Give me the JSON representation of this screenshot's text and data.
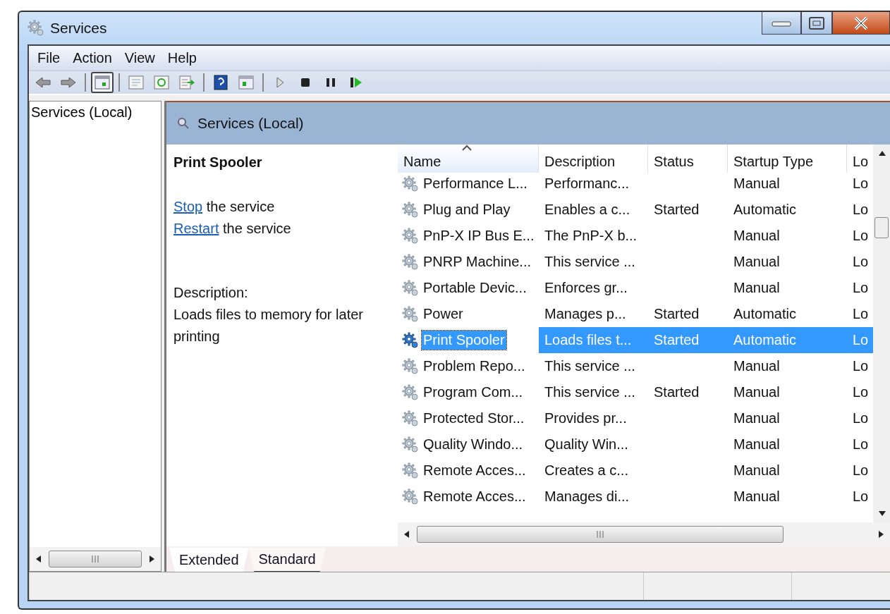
{
  "window": {
    "title": "Services"
  },
  "menu": [
    "File",
    "Action",
    "View",
    "Help"
  ],
  "toolbar": [
    {
      "kind": "back",
      "selected": false
    },
    {
      "kind": "forward",
      "selected": false
    },
    {
      "kind": "separator"
    },
    {
      "kind": "console",
      "selected": true
    },
    {
      "kind": "separator"
    },
    {
      "kind": "properties",
      "selected": false
    },
    {
      "kind": "refresh",
      "selected": false
    },
    {
      "kind": "export",
      "selected": false
    },
    {
      "kind": "separator"
    },
    {
      "kind": "help",
      "selected": false
    },
    {
      "kind": "view",
      "selected": false
    },
    {
      "kind": "separator"
    },
    {
      "kind": "play",
      "selected": false
    },
    {
      "kind": "stop",
      "selected": false
    },
    {
      "kind": "pause",
      "selected": false
    },
    {
      "kind": "resume",
      "selected": false
    }
  ],
  "tree": {
    "items": [
      {
        "label": "Services (Local)",
        "selected": false
      }
    ]
  },
  "header": {
    "title": "Services (Local)"
  },
  "details": {
    "title": "Print Spooler",
    "actions": [
      {
        "link": "Stop",
        "text": " the service"
      },
      {
        "link": "Restart",
        "text": " the service"
      }
    ],
    "description_label": "Description:",
    "description": "Loads files to memory for later printing"
  },
  "table": {
    "columns": [
      {
        "label": "Name",
        "sorted": true
      },
      {
        "label": "Description",
        "sorted": false
      },
      {
        "label": "Status",
        "sorted": false
      },
      {
        "label": "Startup Type",
        "sorted": false
      },
      {
        "label": "Lo",
        "sorted": false
      }
    ],
    "rows": [
      {
        "name": "Performance L...",
        "description": "Performanc...",
        "startup": "Manual",
        "logon": "Lo",
        "selected": false
      },
      {
        "name": "Plug and Play",
        "description": "Enables a c...",
        "status": "Started",
        "startup": "Automatic",
        "logon": "Lo",
        "selected": false
      },
      {
        "name": "PnP-X IP Bus E...",
        "description": "The PnP-X b...",
        "startup": "Manual",
        "logon": "Lo",
        "selected": false
      },
      {
        "name": "PNRP Machine...",
        "description": "This service ...",
        "startup": "Manual",
        "logon": "Lo",
        "selected": false
      },
      {
        "name": "Portable Devic...",
        "description": "Enforces gr...",
        "startup": "Manual",
        "logon": "Lo",
        "selected": false
      },
      {
        "name": "Power",
        "description": "Manages p...",
        "status": "Started",
        "startup": "Automatic",
        "logon": "Lo",
        "selected": false
      },
      {
        "name": "Print Spooler",
        "description": "Loads files t...",
        "status": "Started",
        "startup": "Automatic",
        "logon": "Lo",
        "selected": true
      },
      {
        "name": "Problem Repo...",
        "description": "This service ...",
        "startup": "Manual",
        "logon": "Lo",
        "selected": false
      },
      {
        "name": "Program Com...",
        "description": "This service ...",
        "status": "Started",
        "startup": "Manual",
        "logon": "Lo",
        "selected": false
      },
      {
        "name": "Protected Stor...",
        "description": "Provides pr...",
        "startup": "Manual",
        "logon": "Lo",
        "selected": false
      },
      {
        "name": "Quality Windo...",
        "description": "Quality Win...",
        "startup": "Manual",
        "logon": "Lo",
        "selected": false
      },
      {
        "name": "Remote Acces...",
        "description": "Creates a c...",
        "startup": "Manual",
        "logon": "Lo",
        "selected": false
      },
      {
        "name": "Remote Acces...",
        "description": "Manages di...",
        "startup": "Manual",
        "logon": "Lo",
        "selected": false
      }
    ]
  },
  "tabs": [
    {
      "label": "Extended",
      "selected": true
    },
    {
      "label": "Standard",
      "selected": false
    }
  ]
}
